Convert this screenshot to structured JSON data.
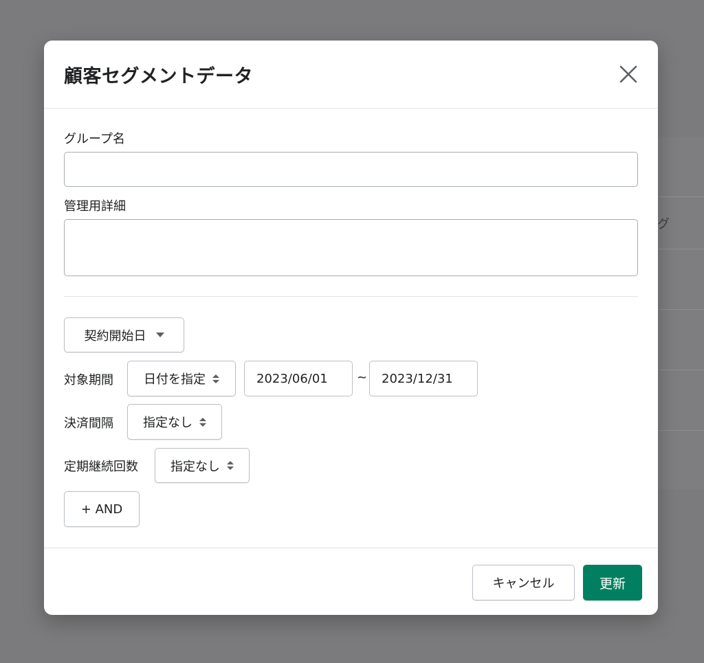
{
  "background": {
    "partial_text": "グ"
  },
  "modal": {
    "title": "顧客セグメントデータ",
    "close_icon": "close-icon"
  },
  "form": {
    "group_name": {
      "label": "グループ名",
      "value": ""
    },
    "admin_detail": {
      "label": "管理用詳細",
      "value": ""
    },
    "condition_type": {
      "label": "契約開始日",
      "icon": "caret-down-icon"
    },
    "target_period": {
      "label": "対象期間",
      "select": "日付を指定",
      "start_date": "2023/06/01",
      "separator": "~",
      "end_date": "2023/12/31"
    },
    "payment_interval": {
      "label": "決済間隔",
      "select": "指定なし"
    },
    "renewal_count": {
      "label": "定期継続回数",
      "select": "指定なし"
    },
    "add_and_label": "+ AND"
  },
  "footer": {
    "cancel_label": "キャンセル",
    "update_label": "更新"
  },
  "colors": {
    "primary": "#008060",
    "overlay": "#7b7b7d"
  }
}
